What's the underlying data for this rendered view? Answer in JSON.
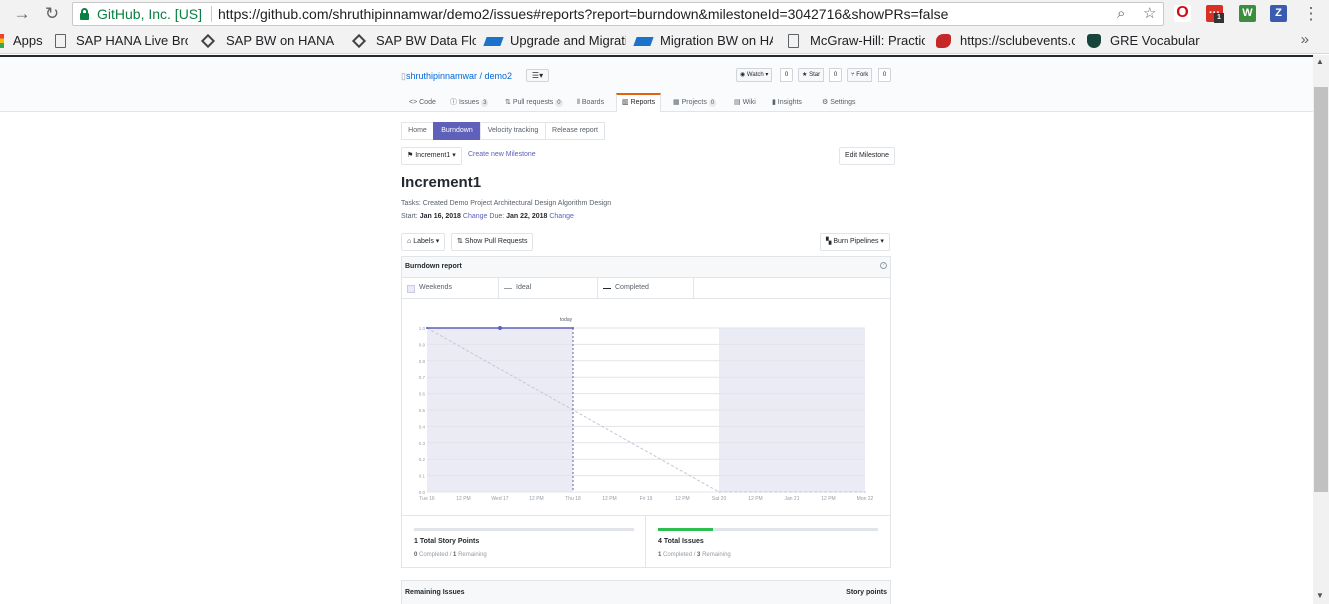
{
  "browser": {
    "org": "GitHub, Inc. [US]",
    "url": "https://github.com/shruthipinnamwar/demo2/issues#reports?report=burndown&milestoneId=3042716&showPRs=false",
    "extension_badge": "1",
    "extension_z": "Z"
  },
  "bookmarks": {
    "items": [
      {
        "label": "Apps",
        "icon": "apps-grid-icon"
      },
      {
        "label": "SAP HANA Live Brows",
        "icon": "page-icon"
      },
      {
        "label": "SAP BW on HANA Mi",
        "icon": "diamond-icon"
      },
      {
        "label": "SAP BW Data Flow",
        "icon": "diamond-icon"
      },
      {
        "label": "Upgrade and Migratio",
        "icon": "sap-icon"
      },
      {
        "label": "Migration BW on HAN",
        "icon": "sap-icon"
      },
      {
        "label": "McGraw-Hill: Practice",
        "icon": "page-icon"
      },
      {
        "label": "https://sclubevents.co",
        "icon": "bird-icon"
      },
      {
        "label": "GRE Vocabulary",
        "icon": "spartan-icon"
      }
    ],
    "more": "»"
  },
  "repo": {
    "title": "shruthipinnamwar / demo2",
    "watch_label": "Watch ▾",
    "watch_count": "0",
    "star_label": "Star",
    "star_count": "0",
    "fork_label": "Fork",
    "fork_count": "0",
    "tabs": [
      {
        "label": "Code",
        "counter": ""
      },
      {
        "label": "Issues",
        "counter": "3"
      },
      {
        "label": "Pull requests",
        "counter": "0"
      },
      {
        "label": "Boards",
        "counter": ""
      },
      {
        "label": "Reports",
        "counter": ""
      },
      {
        "label": "Projects",
        "counter": "0"
      },
      {
        "label": "Wiki",
        "counter": ""
      },
      {
        "label": "Insights",
        "counter": ""
      },
      {
        "label": "Settings",
        "counter": ""
      }
    ]
  },
  "reports_nav": [
    "Home",
    "Burndown",
    "Velocity tracking",
    "Release report"
  ],
  "milestone": {
    "selector": "Increment1",
    "create_link": "Create new Milestone",
    "edit_button": "Edit Milestone",
    "title": "Increment1",
    "tasks": "Tasks: Created Demo Project Architectural Design Algorithm Design",
    "start_label": "Start:",
    "start_date": "Jan 16, 2018",
    "due_label": "Due:",
    "due_date": "Jan 22, 2018",
    "change": "Change"
  },
  "filters": {
    "labels": "Labels",
    "show_prs": "Show Pull Requests",
    "burn_pipelines": "Burn Pipelines"
  },
  "report": {
    "title": "Burndown report",
    "help": "?",
    "legend": [
      "Weekends",
      "Ideal",
      "Completed"
    ]
  },
  "colors": {
    "accent": "#5e60ba",
    "weekend_fill": "#ebebf5",
    "ideal": "#c6c6d6",
    "progress": "#2cbe4e"
  },
  "chart_data": {
    "type": "line",
    "today_label": "today",
    "x_ticks": [
      "Tue 16",
      "12 PM",
      "Wed 17",
      "12 PM",
      "Thu 18",
      "12 PM",
      "Fri 19",
      "12 PM",
      "Sat 20",
      "12 PM",
      "Jan 21",
      "12 PM",
      "Mon 22"
    ],
    "y_ticks": [
      "1.0",
      "0.9",
      "0.8",
      "0.7",
      "0.6",
      "0.5",
      "0.4",
      "0.3",
      "0.2",
      "0.1",
      "0.0"
    ],
    "ylim": [
      0,
      1
    ],
    "shaded_ranges": [
      {
        "name": "elapsed",
        "start": "Tue 16",
        "end": "Thu 18"
      },
      {
        "name": "weekend",
        "start": "Sat 20",
        "end": "Mon 22"
      }
    ],
    "series": [
      {
        "name": "Ideal",
        "x": [
          "Tue 16",
          "Sat 20",
          "Mon 22"
        ],
        "values": [
          1.0,
          0.0,
          0.0
        ]
      },
      {
        "name": "Completed",
        "x": [
          "Tue 16",
          "Wed 17",
          "Thu 18"
        ],
        "values": [
          1.0,
          1.0,
          1.0
        ]
      }
    ],
    "today": "Thu 18"
  },
  "stats": {
    "story_points": {
      "title": "1 Total Story Points",
      "completed": "0",
      "completed_label": "Completed",
      "remaining": "1",
      "remaining_label": "Remaining",
      "progress": 0
    },
    "issues": {
      "title": "4 Total Issues",
      "completed": "1",
      "completed_label": "Completed",
      "remaining": "3",
      "remaining_label": "Remaining",
      "progress": 0.25
    }
  },
  "remaining_issues": {
    "title": "Remaining Issues",
    "story_points": "Story points"
  }
}
